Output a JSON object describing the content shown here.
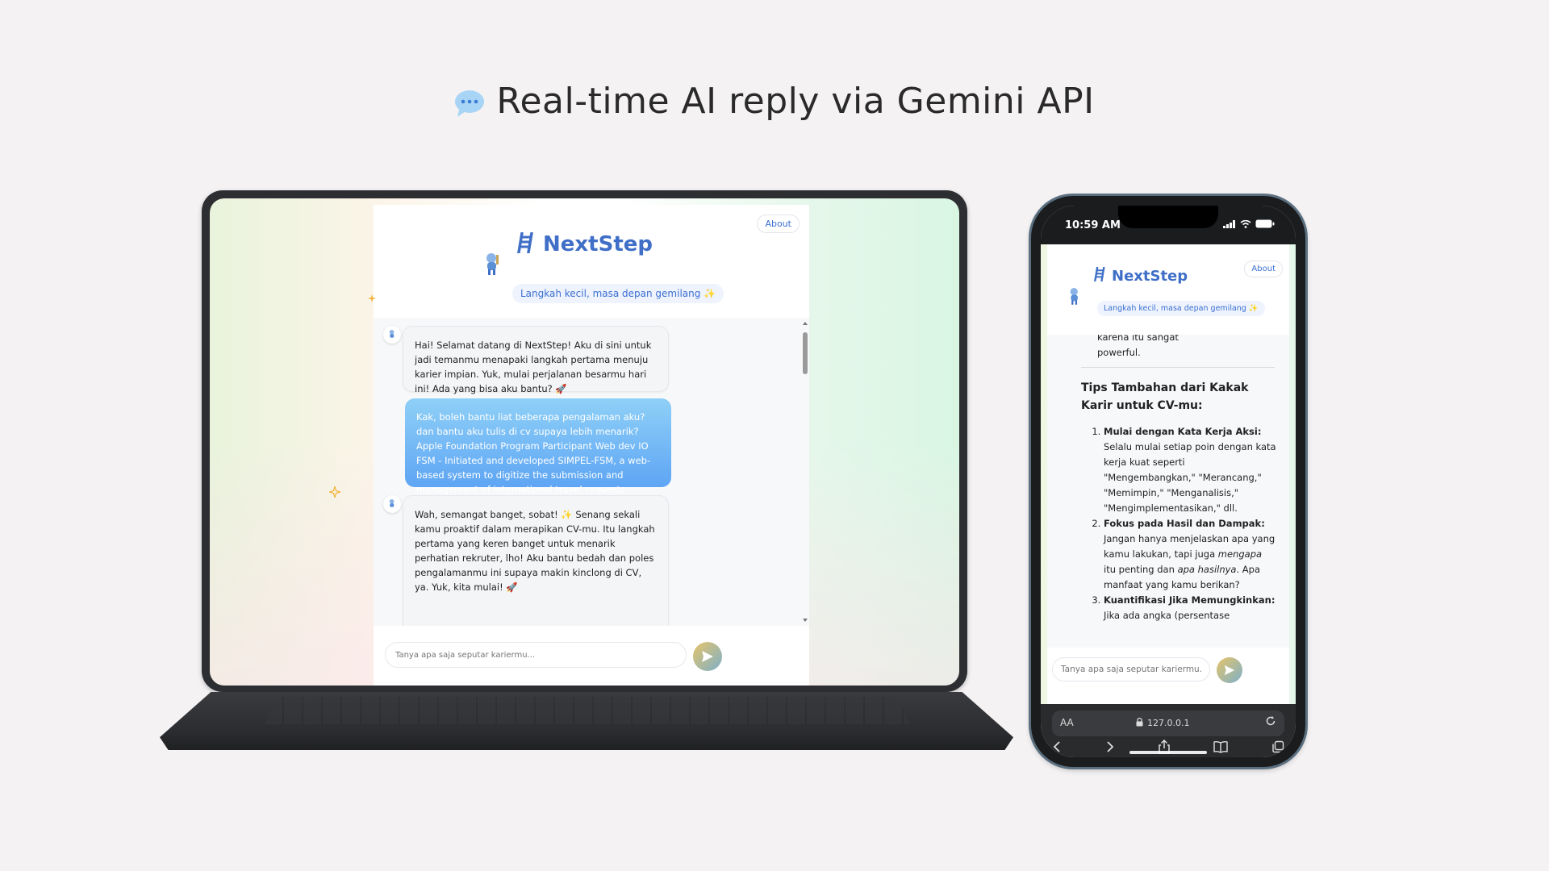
{
  "headline": "Real-time AI reply via Gemini API",
  "desktop": {
    "about_label": "About",
    "app_name": "NextStep",
    "tagline": "Langkah kecil, masa depan gemilang ✨",
    "messages": [
      {
        "role": "bot",
        "text": "Hai! Selamat datang di NextStep! Aku di sini untuk jadi temanmu menapaki langkah pertama menuju karier impian. Yuk, mulai perjalanan besarmu hari ini! Ada yang bisa aku bantu? 🚀"
      },
      {
        "role": "user",
        "text": "Kak, boleh bantu liat beberapa pengalaman aku? dan bantu aku tulis di cv supaya lebih menarik? Apple Foundation Program Participant Web dev IO FSM - Initiated and developed SIMPEL-FSM, a web-based system to digitize the submission and management of international travel requests"
      },
      {
        "role": "bot",
        "text": "Wah, semangat banget, sobat! ✨ Senang sekali kamu proaktif dalam merapikan CV-mu. Itu langkah pertama yang keren banget untuk menarik perhatian rekruter, lho! Aku bantu bedah dan poles pengalamanmu ini supaya makin kinclong di CV, ya. Yuk, kita mulai! 🚀"
      }
    ],
    "input_placeholder": "Tanya apa saja seputar kariermu..."
  },
  "mobile": {
    "status_time": "10:59 AM",
    "about_label": "About",
    "app_name": "NextStep",
    "tagline": "Langkah kecil, masa depan gemilang ✨",
    "partial_top": "karena itu sangat powerful.",
    "section_heading": "Tips Tambahan dari Kakak Karir untuk CV-mu:",
    "tips": [
      {
        "title": "Mulai dengan Kata Kerja Aksi:",
        "body": "Selalu mulai setiap poin dengan kata kerja kuat seperti \"Mengembangkan,\" \"Merancang,\" \"Memimpin,\" \"Menganalisis,\" \"Mengimplementasikan,\" dll."
      },
      {
        "title": "Fokus pada Hasil dan Dampak:",
        "body_before": "Jangan hanya menjelaskan apa yang kamu lakukan, tapi juga ",
        "em1": "mengapa",
        "body_mid": " itu penting dan ",
        "em2": "apa hasilnya",
        "body_after": ". Apa manfaat yang kamu berikan?"
      },
      {
        "title": "Kuantifikasi Jika Memungkinkan:",
        "body": "Jika ada angka (persentase"
      }
    ],
    "input_placeholder": "Tanya apa saja seputar kariermu...",
    "url_aa": "AA",
    "url": "127.0.0.1"
  },
  "colors": {
    "brand": "#3f6fc7",
    "user_bubble": "#5ea5f4",
    "background": "#f4f2f3"
  }
}
